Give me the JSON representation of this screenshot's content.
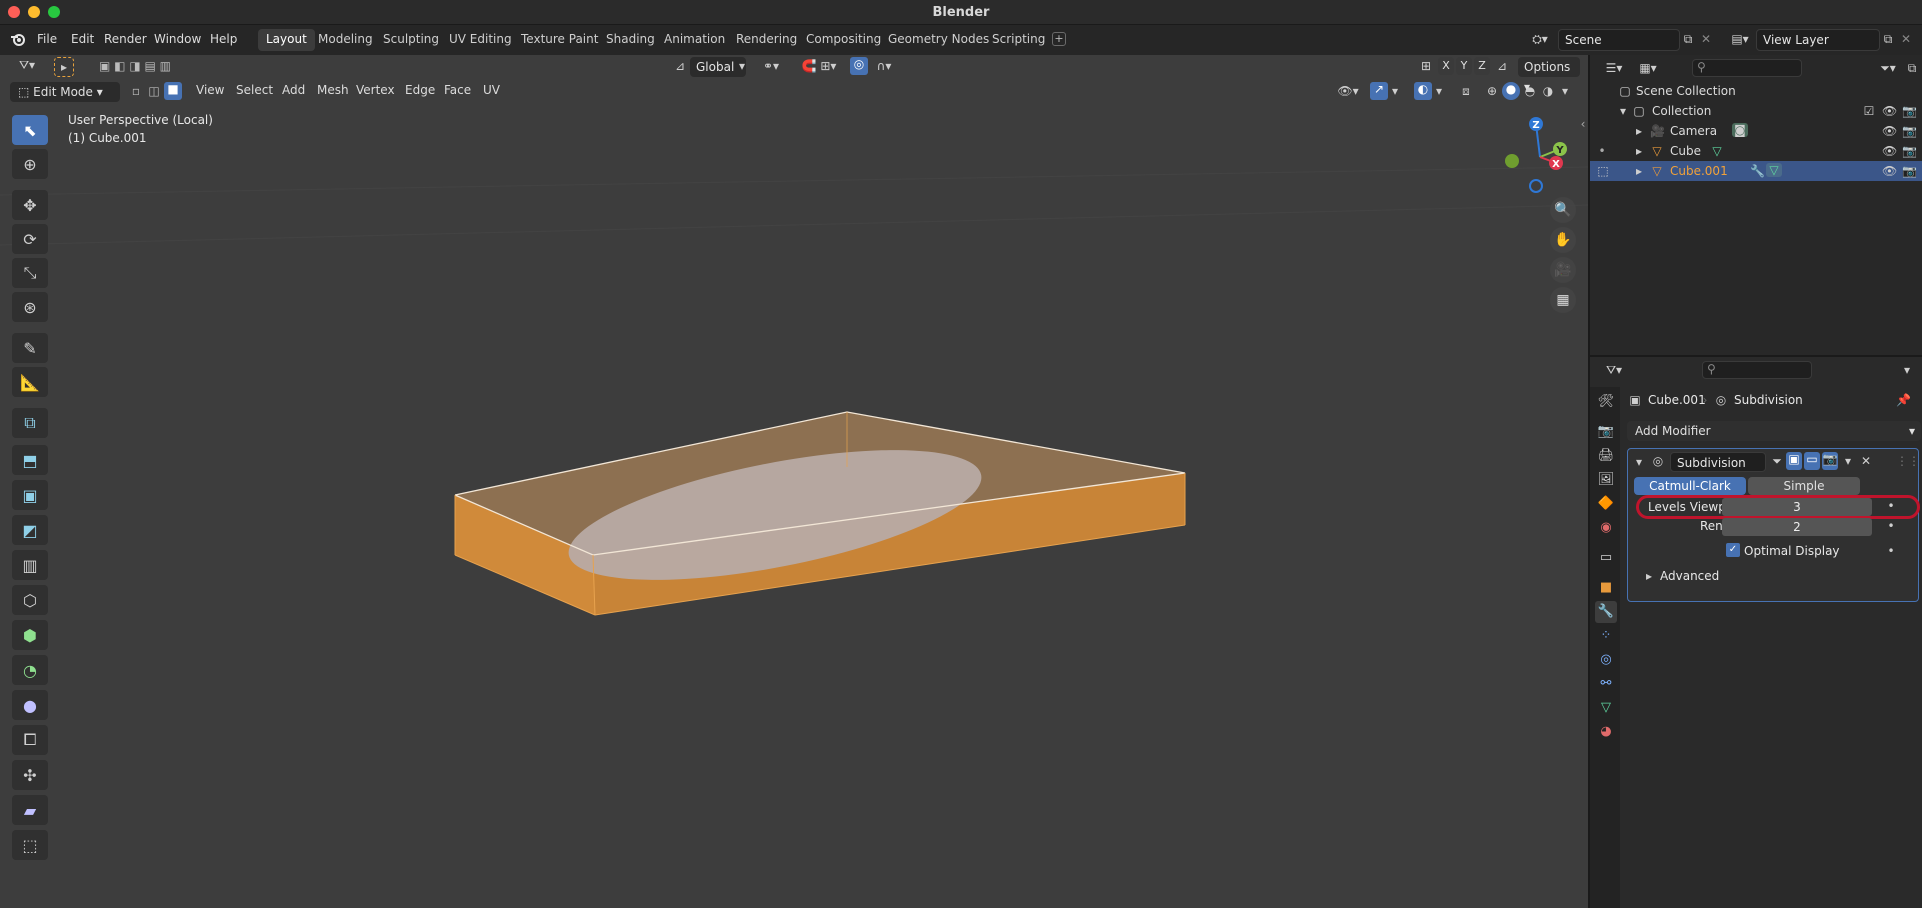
{
  "window": {
    "title": "Blender"
  },
  "menus": [
    "File",
    "Edit",
    "Render",
    "Window",
    "Help"
  ],
  "workspaces": [
    "Layout",
    "Modeling",
    "Sculpting",
    "UV Editing",
    "Texture Paint",
    "Shading",
    "Animation",
    "Rendering",
    "Compositing",
    "Geometry Nodes",
    "Scripting"
  ],
  "active_workspace": "Layout",
  "scene": {
    "name": "Scene",
    "view_layer": "View Layer"
  },
  "viewport": {
    "mode": "Edit Mode",
    "menus": [
      "View",
      "Select",
      "Add",
      "Mesh",
      "Vertex",
      "Edge",
      "Face",
      "UV"
    ],
    "transform_orientation": "Global",
    "options_label": "Options",
    "perspective_text": "User Perspective (Local)",
    "object_text": "(1) Cube.001",
    "axes": {
      "x": "X",
      "y": "Y",
      "z": "Z"
    },
    "gizmo": {
      "z": "Z",
      "y": "Y",
      "x": "X"
    }
  },
  "outliner": {
    "scene_collection": "Scene Collection",
    "collection": "Collection",
    "items": [
      {
        "label": "Camera",
        "selected": false
      },
      {
        "label": "Cube",
        "selected": false
      },
      {
        "label": "Cube.001",
        "selected": true
      }
    ]
  },
  "properties": {
    "breadcrumb_object": "Cube.001",
    "breadcrumb_modifier": "Subdivision",
    "add_modifier": "Add Modifier",
    "modifier": {
      "name": "Subdivision",
      "type_options": [
        "Catmull-Clark",
        "Simple"
      ],
      "active_type": "Catmull-Clark",
      "levels_viewport_label": "Levels Viewport",
      "levels_viewport_value": "3",
      "render_label": "Render",
      "render_value": "2",
      "optimal_display_label": "Optimal Display",
      "optimal_display_checked": true,
      "advanced_label": "Advanced"
    }
  },
  "colors": {
    "accent": "#4772b3",
    "selection_orange": "#e8993d",
    "highlight_ring": "#c0142c"
  }
}
